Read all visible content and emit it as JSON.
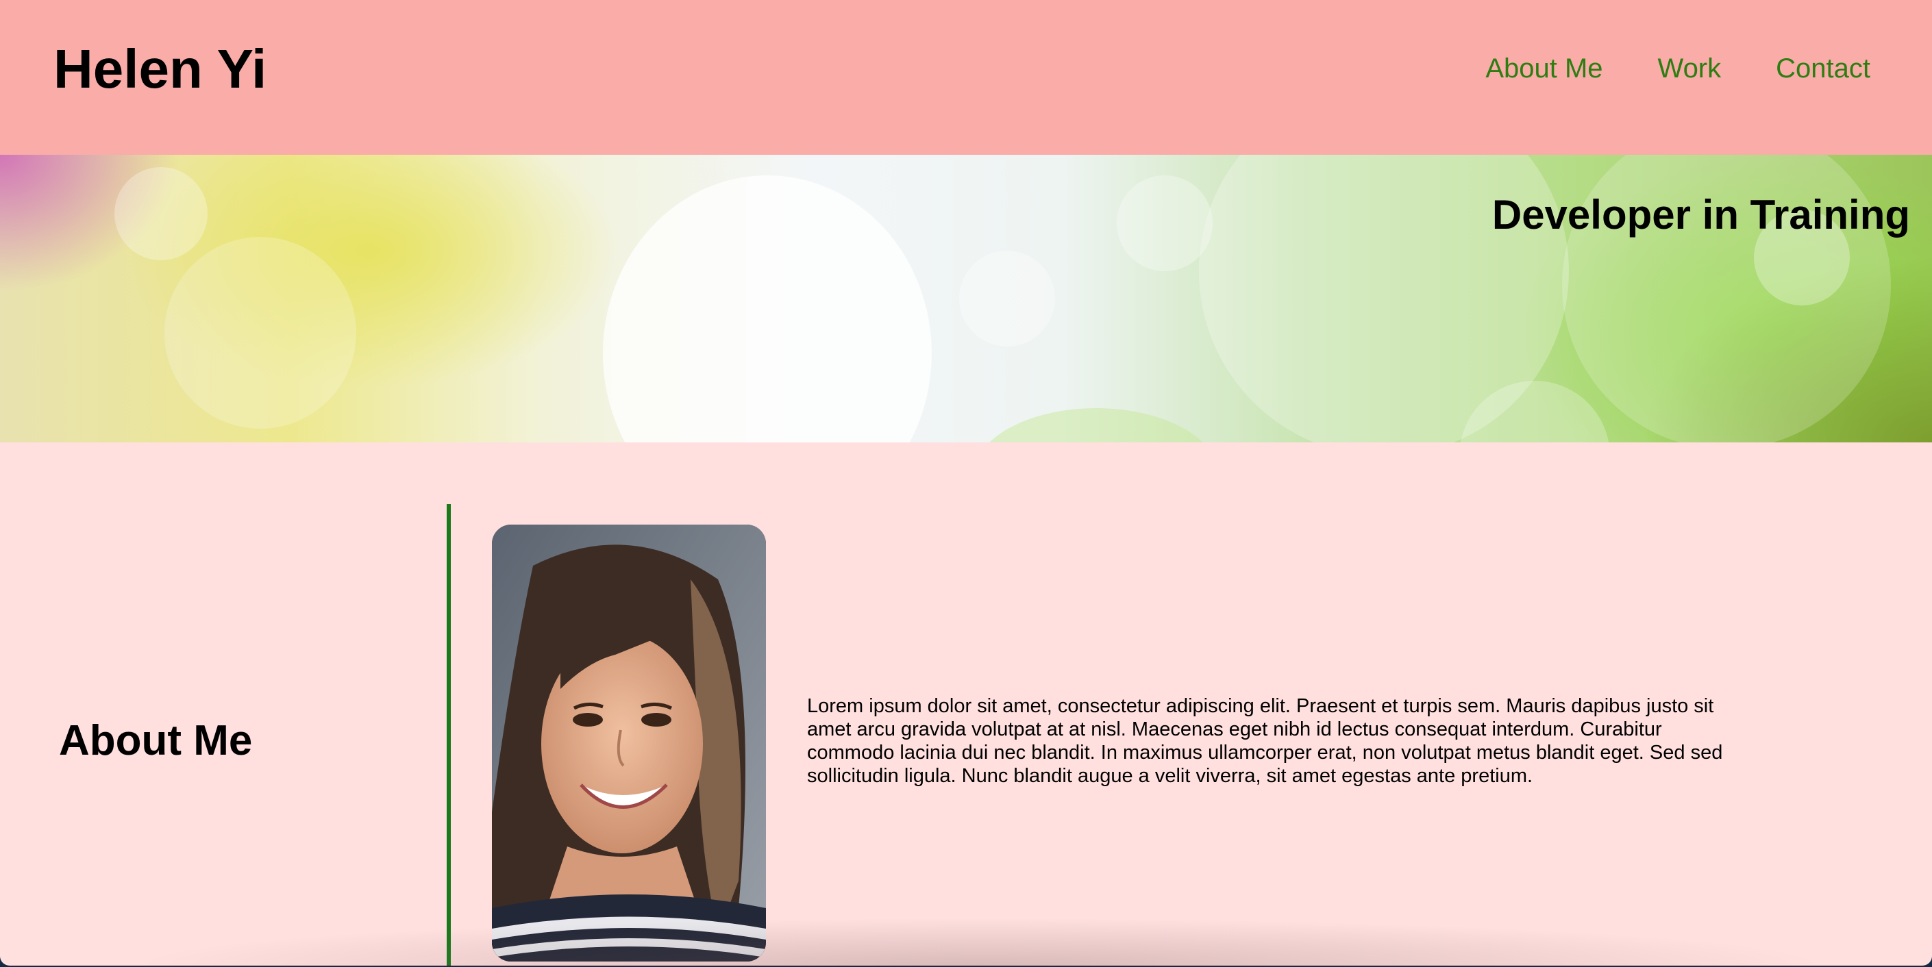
{
  "header": {
    "site_name": "Helen Yi",
    "nav": {
      "about": "About Me",
      "work": "Work",
      "contact": "Contact"
    }
  },
  "hero": {
    "tagline": "Developer in Training"
  },
  "about": {
    "heading": "About Me",
    "text": "Lorem ipsum dolor sit amet, consectetur adipiscing elit. Praesent et turpis sem. Mauris dapibus justo sit amet arcu gravida volutpat at at nisl. Maecenas eget nibh id lectus consequat interdum. Curabitur commodo lacinia dui nec blandit. In maximus ullamcorper erat, non volutpat metus blandit eget. Sed sed sollicitudin ligula. Nunc blandit augue a velit viverra, sit amet egestas ante pretium."
  },
  "colors": {
    "header_bg": "#f9aca8",
    "page_bg": "#ffe0df",
    "nav_link": "#2e7d12",
    "divider": "#1a7a1a"
  }
}
